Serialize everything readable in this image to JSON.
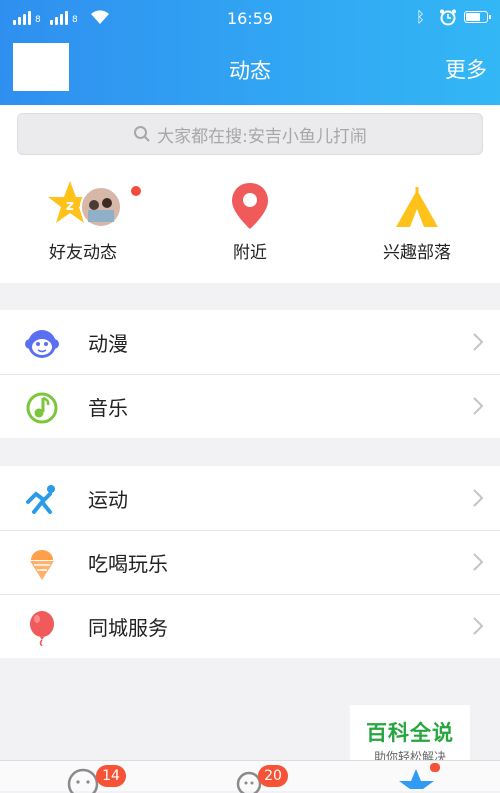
{
  "status_bar": {
    "time": "16:59",
    "sim1_label": "8",
    "sim2_label": "8",
    "battery_level": 0.75
  },
  "header": {
    "title": "动态",
    "more_label": "更多"
  },
  "search": {
    "icon": "search-icon",
    "placeholder": "大家都在搜:安吉小鱼儿打闹"
  },
  "features": [
    {
      "label": "好友动态",
      "icon": "qzone-star-icon",
      "has_dot": true
    },
    {
      "label": "附近",
      "icon": "location-pin-icon"
    },
    {
      "label": "兴趣部落",
      "icon": "tent-icon"
    }
  ],
  "group1": [
    {
      "label": "动漫",
      "icon": "monkey-face-icon"
    },
    {
      "label": "音乐",
      "icon": "music-note-icon"
    }
  ],
  "group2": [
    {
      "label": "运动",
      "icon": "running-icon"
    },
    {
      "label": "吃喝玩乐",
      "icon": "ice-cream-icon"
    },
    {
      "label": "同城服务",
      "icon": "balloon-icon"
    }
  ],
  "watermark": {
    "title": "百科全说",
    "subtitle": "助你轻松解决"
  },
  "tabbar": {
    "messages_badge": "14",
    "contacts_badge": "20"
  },
  "colors": {
    "header_start": "#2f8ff0",
    "header_end": "#33b7f5",
    "badge_red": "#f55236"
  }
}
